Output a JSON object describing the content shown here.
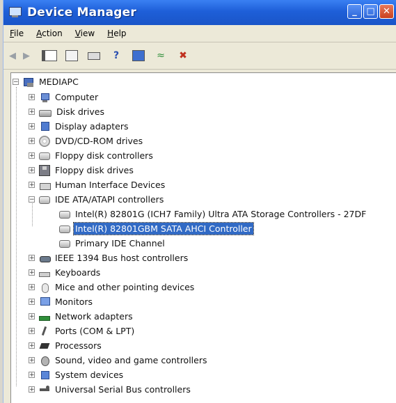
{
  "window": {
    "title": "Device Manager",
    "buttons": {
      "minimize": "_",
      "maximize": "□",
      "close": "✕"
    }
  },
  "menu": [
    {
      "label_u": "F",
      "label_rest": "ile"
    },
    {
      "label_u": "A",
      "label_rest": "ction"
    },
    {
      "label_u": "V",
      "label_rest": "iew"
    },
    {
      "label_u": "H",
      "label_rest": "elp"
    }
  ],
  "toolbar": [
    "back-arrow-icon",
    "forward-arrow-icon",
    "show-hide-console-tree-icon",
    "properties-icon",
    "print-icon",
    "help-icon",
    "scan-hardware-icon",
    "update-driver-icon",
    "uninstall-icon"
  ],
  "tree": {
    "root": {
      "label": "MEDIAPC",
      "expander": "−"
    },
    "items": [
      {
        "label": "Computer",
        "expander": "+",
        "icon": "computer-icon"
      },
      {
        "label": "Disk drives",
        "expander": "+",
        "icon": "disk-drive-icon"
      },
      {
        "label": "Display adapters",
        "expander": "+",
        "icon": "display-adapter-icon"
      },
      {
        "label": "DVD/CD-ROM drives",
        "expander": "+",
        "icon": "dvd-drive-icon"
      },
      {
        "label": "Floppy disk controllers",
        "expander": "+",
        "icon": "floppy-controller-icon"
      },
      {
        "label": "Floppy disk drives",
        "expander": "+",
        "icon": "floppy-drive-icon"
      },
      {
        "label": "Human Interface Devices",
        "expander": "+",
        "icon": "hid-icon"
      },
      {
        "label": "IDE ATA/ATAPI controllers",
        "expander": "−",
        "icon": "ide-controller-icon"
      },
      {
        "label": "Intel(R) 82801G (ICH7 Family) Ultra ATA Storage Controllers - 27DF",
        "icon": "ide-controller-icon",
        "child": true
      },
      {
        "label": "Intel(R) 82801GBM SATA AHCI Controller",
        "icon": "ide-controller-icon",
        "child": true,
        "selected": true
      },
      {
        "label": "Primary IDE Channel",
        "icon": "ide-controller-icon",
        "child": true
      },
      {
        "label": "IEEE 1394 Bus host controllers",
        "expander": "+",
        "icon": "ieee1394-icon"
      },
      {
        "label": "Keyboards",
        "expander": "+",
        "icon": "keyboard-icon"
      },
      {
        "label": "Mice and other pointing devices",
        "expander": "+",
        "icon": "mouse-icon"
      },
      {
        "label": "Monitors",
        "expander": "+",
        "icon": "monitor-icon"
      },
      {
        "label": "Network adapters",
        "expander": "+",
        "icon": "network-adapter-icon"
      },
      {
        "label": "Ports (COM & LPT)",
        "expander": "+",
        "icon": "ports-icon"
      },
      {
        "label": "Processors",
        "expander": "+",
        "icon": "processor-icon"
      },
      {
        "label": "Sound, video and game controllers",
        "expander": "+",
        "icon": "sound-icon"
      },
      {
        "label": "System devices",
        "expander": "+",
        "icon": "system-devices-icon"
      },
      {
        "label": "Universal Serial Bus controllers",
        "expander": "+",
        "icon": "usb-icon"
      }
    ]
  },
  "colors": {
    "titlebar": "#1e5fd8",
    "selection": "#316ac5",
    "chrome": "#ece9d8"
  }
}
